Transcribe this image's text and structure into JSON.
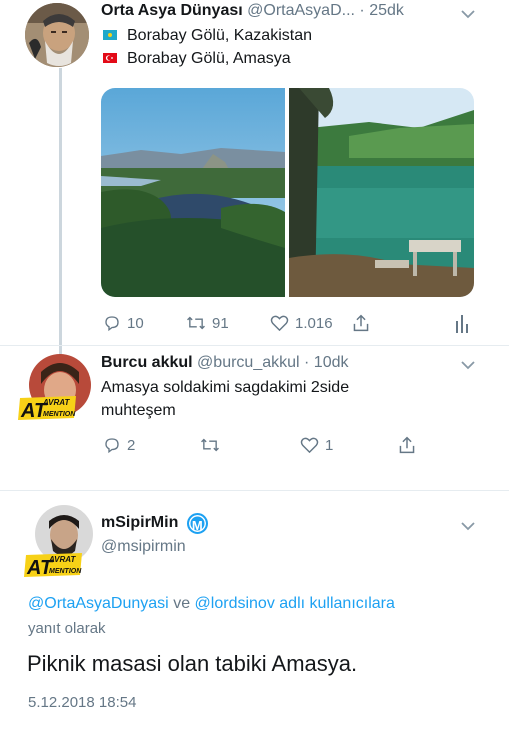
{
  "tweet1": {
    "name": "Orta Asya Dünyası",
    "handle": "@OrtaAsyaD...",
    "time": "· 25dk",
    "lines": [
      {
        "flag": "kazakhstan-flag",
        "text": "Borabay Gölü, Kazakistan"
      },
      {
        "flag": "turkey-flag",
        "text": "Borabay Gölü, Amasya"
      }
    ],
    "replies": "10",
    "retweets": "91",
    "likes": "1.016"
  },
  "tweet2": {
    "name": "Burcu akkul",
    "handle": "@burcu_akkul",
    "time": "· 10dk",
    "text_line1": "Amasya soldakimi sagdakimi 2side",
    "text_line2": "muhteşem",
    "replies": "2",
    "retweets": "",
    "likes": "1"
  },
  "tweet3": {
    "name": "mSipirMin",
    "verified_letter": "M",
    "handle": "@msipirmin",
    "reply_to_user1": "@OrtaAsyaDunyasi",
    "reply_to_and": "ve",
    "reply_to_user2": "@lordsinov",
    "reply_to_suffix": "adlı kullanıcılara",
    "reply_to_line2": "yanıt olarak",
    "text": "Piknik masasi olan tabiki Amasya.",
    "timestamp": "5.12.2018 18:54"
  },
  "badge": {
    "at": "AT",
    "top": "AVRAT",
    "bottom": "MENTION"
  },
  "colors": {
    "accent": "#1da1f2",
    "secondary_text": "#657786",
    "divider": "#e6ecf0",
    "badge_yellow": "#f7d117"
  }
}
